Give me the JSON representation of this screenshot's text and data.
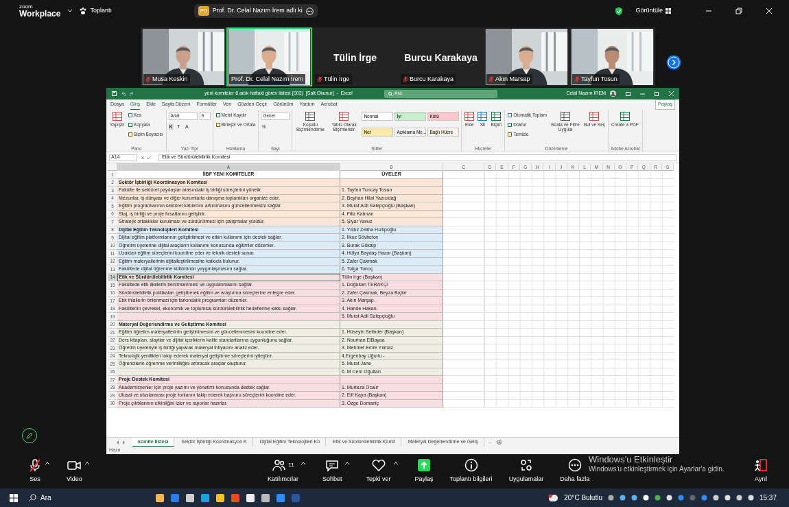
{
  "zoom_bar": {
    "brand_small": "zoom",
    "brand": "Workplace",
    "menu": "Toplantı",
    "share_initials": "PD",
    "share_banner": "Prof. Dr. Celal Nazım İrem adlı ki",
    "view": "Görüntüle"
  },
  "video_tiles": [
    {
      "kind": "video",
      "name": "Musa Keskin",
      "muted": true,
      "speaking": false
    },
    {
      "kind": "video",
      "name": "Prof. Dr. Celal Nazım İrem",
      "muted": false,
      "speaking": true
    },
    {
      "kind": "name",
      "display": "Tülin İrge",
      "name": "Tülin İrge",
      "muted": true,
      "speaking": false
    },
    {
      "kind": "name",
      "display": "Burcu Karakaya",
      "name": "Burcu Karakaya",
      "muted": true,
      "speaking": false
    },
    {
      "kind": "video",
      "name": "Akın Marsap",
      "muted": true,
      "speaking": false
    },
    {
      "kind": "video",
      "name": "Tayfun Tosun",
      "muted": true,
      "speaking": false
    }
  ],
  "excel": {
    "title": "yeni komiteler 6 aıtık haftaki görev listesi (002)  [Salt Okunur]  -  Excel",
    "search_placeholder": "Ara",
    "user": "Celal Nazım İREM",
    "menu_tabs": [
      {
        "label": "Dosya",
        "selected": false
      },
      {
        "label": "Giriş",
        "selected": true
      },
      {
        "label": "Ekle",
        "selected": false
      },
      {
        "label": "Sayfa Düzeni",
        "selected": false
      },
      {
        "label": "Formüller",
        "selected": false
      },
      {
        "label": "Veri",
        "selected": false
      },
      {
        "label": "Gözden Geçir",
        "selected": false
      },
      {
        "label": "Görünüm",
        "selected": false
      },
      {
        "label": "Yardım",
        "selected": false
      },
      {
        "label": "Acrobat",
        "selected": false
      }
    ],
    "share": "Paylaş",
    "ribbon_groups": [
      {
        "label": "Pano",
        "items": [
          {
            "kind": "large",
            "label": "Yapıştır"
          },
          {
            "kind": "small",
            "label": "Kes"
          },
          {
            "kind": "small",
            "label": "Kopyala"
          },
          {
            "kind": "small",
            "label": "Biçim Boyacısı"
          }
        ]
      },
      {
        "label": "Yazı Tipi",
        "items": [
          {
            "kind": "fields",
            "values": [
              "Arial",
              "9"
            ]
          },
          {
            "kind": "glyphs",
            "glyphs": [
              "K",
              "T",
              "A"
            ]
          }
        ]
      },
      {
        "label": "Hizalama",
        "items": [
          {
            "kind": "small",
            "label": "Metni Kaydır"
          },
          {
            "kind": "small",
            "label": "Birleştir ve Ortala"
          }
        ]
      },
      {
        "label": "Sayı",
        "items": [
          {
            "kind": "fields",
            "values": [
              "Genel"
            ]
          },
          {
            "kind": "glyphs",
            "glyphs": [
              "%"
            ]
          }
        ]
      },
      {
        "label": "Stiller",
        "items": [
          {
            "kind": "large",
            "label": "Koşullu Biçimlendirme"
          },
          {
            "kind": "large",
            "label": "Tablo Olarak Biçimlendir"
          },
          {
            "kind": "styles",
            "styles": [
              {
                "label": "Normal",
                "color": "#ffffff"
              },
              {
                "label": "İyi",
                "color": "#c6efce"
              },
              {
                "label": "Kötü",
                "color": "#ffc7ce"
              },
              {
                "label": "Not",
                "color": "#fdeaa8"
              },
              {
                "label": "Açıklama Me...",
                "color": "#f7f7f7"
              },
              {
                "label": "Bağlı Hücre",
                "color": "#fbf3ea"
              }
            ]
          }
        ]
      },
      {
        "label": "Hücreler",
        "items": [
          {
            "kind": "large",
            "label": "Ekle"
          },
          {
            "kind": "large",
            "label": "Sil"
          },
          {
            "kind": "large",
            "label": "Biçim"
          }
        ]
      },
      {
        "label": "Düzenleme",
        "items": [
          {
            "kind": "small",
            "label": "Otomatik Toplam"
          },
          {
            "kind": "small",
            "label": "Doldur"
          },
          {
            "kind": "small",
            "label": "Temizle"
          },
          {
            "kind": "large",
            "label": "Sırala ve Filtre Uygula"
          },
          {
            "kind": "large",
            "label": "Bul ve Seç"
          }
        ]
      },
      {
        "label": "Adobe Acrobat",
        "items": [
          {
            "kind": "large",
            "label": "Create a PDF"
          }
        ]
      }
    ],
    "name_box": "A14",
    "formula": "Etik ve Sürdürülebilirlik Komitesi",
    "columns": [
      "A",
      "B",
      "C",
      "D",
      "E",
      "F",
      "G",
      "H",
      "I",
      "J",
      "K",
      "L",
      "M",
      "N",
      "O",
      "P",
      "Q",
      "R",
      "S"
    ],
    "rows": [
      {
        "number": "1",
        "kind": "header",
        "a": "İİBF YENİ KOMİTELER",
        "b": "ÜYELER",
        "color": "#ffffff",
        "selected": false
      },
      {
        "number": "2",
        "kind": "title",
        "a": "Sektör İşbirliği Koordinasyon Komitesi",
        "color": "#fbe5d6",
        "selected": false
      },
      {
        "number": "3",
        "kind": "item",
        "a": "Fakülte ile sektörel paydaşlar arasındaki iş birliği süreçlerini yönetir.",
        "b": "1. Tayfun Tuncay Tosun",
        "color": "#fbe5d6",
        "selected": false
      },
      {
        "number": "4",
        "kind": "item",
        "a": "Mezunlar, iş dünyası ve diğer kurumlarla danışma toplantıları organize eder.",
        "b": "2. Beyhan Hilal Yazıcıdağ",
        "color": "#fbe5d6",
        "selected": false
      },
      {
        "number": "5",
        "kind": "item",
        "a": "Eğitim programlarının sektörel katılımını artırılmasını güncellenmesini sağlar.",
        "b": "3. Murat Adil Salepçioğlu (Başkan)",
        "color": "#fbe5d6",
        "selected": false
      },
      {
        "number": "6",
        "kind": "item",
        "a": "Staj, iş birliği ve proje fırsatlarını geliştirir.",
        "b": "4. Filiz Katman",
        "color": "#fbe5d6",
        "selected": false
      },
      {
        "number": "7",
        "kind": "item",
        "a": "Stratejik ortaklıklar kurulması ve sürdürülmesi için çalışmalar yürütür.",
        "b": "5. Şiyar Yavuz",
        "color": "#fbe5d6",
        "selected": false
      },
      {
        "number": "8",
        "kind": "title",
        "a": "Dijital Eğitim Teknolojileri Komitesi",
        "b": "1. Yıldız Zeliha Hızlıpoğlu",
        "color": "#ddebf7",
        "selected": false
      },
      {
        "number": "9",
        "kind": "item",
        "a": "Dijital eğitim platformlarının geliştirilmesi ve etkin kullanımı için destek sağlar.",
        "b": "2. İlkuz Sövbetov",
        "color": "#ddebf7",
        "selected": false
      },
      {
        "number": "10",
        "kind": "item",
        "a": "Öğretim üyelerine dijital araçların kullanımı konusunda eğitimler düzenler.",
        "b": "3. Burak Gökalp",
        "color": "#ddebf7",
        "selected": false
      },
      {
        "number": "11",
        "kind": "item",
        "a": "Uzaktan eğitim süreçlerini koordine eder ve teknik destek sunar.",
        "b": "4. Hülya Baydaş Hazar (Başkan)",
        "color": "#ddebf7",
        "selected": false
      },
      {
        "number": "12",
        "kind": "item",
        "a": "Eğitim materyallerinin dijitalleştirilmesine katkıda bulunur.",
        "b": "5. Zafer Çakmak",
        "color": "#ddebf7",
        "selected": false
      },
      {
        "number": "13",
        "kind": "item",
        "a": "Fakültede dijital öğrenme kültürünün yaygınlaşmasını sağlar.",
        "b": "6. Tolga Tunoç",
        "color": "#ddebf7",
        "selected": false
      },
      {
        "number": "14",
        "kind": "title",
        "a": "Etik ve Sürdürülebilirlik Komitesi",
        "b": "Tülin İrge (Başkan)",
        "color": "#f8dde1",
        "selected": true
      },
      {
        "number": "15",
        "kind": "item",
        "a": "Fakültede etik ilkelerin benimsenmesi ve uygulanmasını sağlar.",
        "b": "1. Doğukan TERAKÇİ",
        "color": "#f8dde1",
        "selected": false
      },
      {
        "number": "16",
        "kind": "item",
        "a": "Sürdürülebilirlik politikaları geliştirerek eğitim ve araştırma süreçlerine entegre eder.",
        "b": "2. Zafer Çakmak, Beyza Bıçkır",
        "color": "#f8dde1",
        "selected": false
      },
      {
        "number": "17",
        "kind": "item",
        "a": "Etik ihlallerin önlenmesi için farkındalık programları düzenler.",
        "b": "3. Akın Marşap.",
        "color": "#f8dde1",
        "selected": false
      },
      {
        "number": "18",
        "kind": "item",
        "a": "Fakültenin çevresel, ekonomik ve toplumsal sürdürülebilirlik hedeflerine katkı sağlar.",
        "b": "4. Hande Hakan.",
        "color": "#f8dde1",
        "selected": false
      },
      {
        "number": "19",
        "kind": "item",
        "b": "5. Murat Adil Salepçioğlu",
        "color": "#f8dde1",
        "selected": false
      },
      {
        "number": "20",
        "kind": "title",
        "a": "Materyal Değerlendirme ve Geliştirme Komitesi",
        "color": "#efeee3",
        "selected": false
      },
      {
        "number": "21",
        "kind": "item",
        "a": "Eğitim öğretim materyallerinin geliştirilmesini ve güncellenmesini koordine eder.",
        "b": "1. Hüseyin Selimler (Başkan)",
        "color": "#efeee3",
        "selected": false
      },
      {
        "number": "22",
        "kind": "item",
        "a": "Ders kitapları, slaytlar ve dijital içeriklerin kalite standartlarına uygunluğunu sağlar.",
        "b": "2. Nourhan ElBayaa",
        "color": "#efeee3",
        "selected": false
      },
      {
        "number": "23",
        "kind": "item",
        "a": "Öğretim üyeleriyle iş birliği yaparak materyal ihtiyacını analiz eder.",
        "b": "3. Mehmet Emre Yılmaz",
        "color": "#efeee3",
        "selected": false
      },
      {
        "number": "24",
        "kind": "item",
        "a": "Teknolojik yenilikleri takip ederek materyal geliştirme süreçlerini iyileştirir.",
        "b": "4.Ergenbay Uğurlu -",
        "color": "#efeee3",
        "selected": false
      },
      {
        "number": "25",
        "kind": "item",
        "a": "Öğrencilerin öğrenme verimliliğini artıracak araçlar oluşturur.",
        "b": "5. Murat Jane",
        "color": "#efeee3",
        "selected": false
      },
      {
        "number": "26",
        "kind": "item",
        "b": "6. M Cem Oğultan",
        "color": "#efeee3",
        "selected": false
      },
      {
        "number": "27",
        "kind": "title",
        "a": "Proje Destek Komitesi",
        "color": "#f8dde1",
        "selected": false
      },
      {
        "number": "28",
        "kind": "item",
        "a": "Akademisyenler için proje yazımı ve yönetimi konusunda destek sağlar.",
        "b": "1. Murteza Öcalır",
        "color": "#f8dde1",
        "selected": false
      },
      {
        "number": "29",
        "kind": "item",
        "a": "Ulusal ve uluslararası proje fonlarını takip ederek başvuru süreçlerini koordine eder.",
        "b": "2. Elif Kaya (Başkan)",
        "color": "#f8dde1",
        "selected": false
      },
      {
        "number": "30",
        "kind": "item",
        "a": "Proje çıktılarının etkinliğini izler ve raporlar hazırlar.",
        "b": "3. Özge Domaniç",
        "color": "#f8dde1",
        "selected": false
      }
    ],
    "sheet_tabs": [
      {
        "label": "komite listesi",
        "selected": true
      },
      {
        "label": "Sektör İşbirliği Koordinasyon K",
        "selected": false
      },
      {
        "label": "Dijital Eğitim Teknolojileri Ko",
        "selected": false
      },
      {
        "label": "Etik ve Sürdürülebilirlik Komit",
        "selected": false
      },
      {
        "label": "Materyal Değerlendirme ve Geliş",
        "selected": false
      }
    ],
    "sheet_overflow": "...",
    "status": "Hazır"
  },
  "activation_notice": {
    "title": "Windows'u Etkinleştir",
    "text": "Windows'u etkinleştirmek için Ayarlar'a gidin."
  },
  "toolbar": [
    {
      "kind": "mic",
      "label": "Ses",
      "muted": true,
      "caret": true
    },
    {
      "kind": "camera",
      "label": "Video",
      "caret": true
    },
    {
      "kind": "participants",
      "label": "Katılımcılar",
      "count": "11",
      "caret": true
    },
    {
      "kind": "chat",
      "label": "Sohbet",
      "caret": true
    },
    {
      "kind": "reaction",
      "label": "Tepki ver",
      "caret": true
    },
    {
      "kind": "share",
      "label": "Paylaş",
      "caret": false
    },
    {
      "kind": "info",
      "label": "Toplantı bilgileri",
      "caret": false
    },
    {
      "kind": "apps",
      "label": "Uygulamalar",
      "caret": false
    },
    {
      "kind": "more",
      "label": "Daha fazla",
      "caret": false
    },
    {
      "kind": "leave",
      "label": "Ayrıl",
      "caret": false
    }
  ],
  "taskbar": {
    "search": "Ara",
    "weather": "20°C Bulutlu",
    "time": "15:37"
  }
}
